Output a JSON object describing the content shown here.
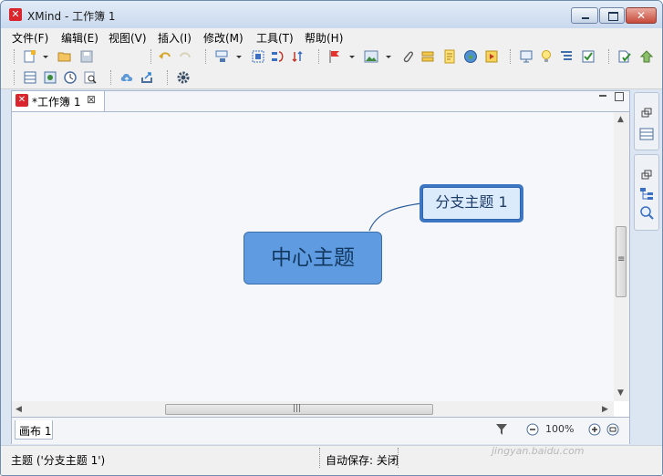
{
  "window": {
    "title": "XMind - 工作簿 1",
    "logo_icon": "xmind-logo-icon",
    "close_glyph": "✕"
  },
  "menubar": {
    "items": [
      "文件(F)",
      "编辑(E)",
      "视图(V)",
      "插入(I)",
      "修改(M)",
      "工具(T)",
      "帮助(H)"
    ]
  },
  "toolbar": {
    "row1_icons": [
      "new-workbook-icon",
      "dropdown-arrow-icon",
      "open-folder-icon",
      "save-icon",
      "undo-icon",
      "redo-icon",
      "insert-topic-icon",
      "dropdown-arrow-icon",
      "boundary-icon",
      "relationship-icon",
      "summary-icon",
      "flag-marker-icon",
      "dropdown-arrow-icon",
      "image-icon",
      "dropdown-arrow-icon",
      "attachment-icon",
      "label-icon",
      "note-icon",
      "hyperlink-globe-icon",
      "audio-note-icon",
      "presentation-icon",
      "idea-lightbulb-icon",
      "outliner-icon",
      "task-icon",
      "spellcheck-icon",
      "go-up-icon"
    ],
    "row2_icons": [
      "sheet-icon",
      "image-export-icon",
      "clock-icon",
      "search-icon",
      "upload-cloud-icon",
      "share-icon",
      "preferences-gear-icon"
    ]
  },
  "editor": {
    "tab_label": "*工作簿 1",
    "tab_close_glyph": "⊠",
    "central_topic": "中心主题",
    "branch_topic": "分支主题 1",
    "sheet_tab": "画布 1",
    "zoom_level": "100%",
    "hscroll_grip": "|||",
    "vscroll_grip": "≡",
    "scroll_left": "◀",
    "scroll_right": "▶",
    "scroll_up": "▲",
    "scroll_down": "▼"
  },
  "statusbar": {
    "selection": "主题 ('分支主题 1')",
    "autosave": "自动保存: 关闭",
    "watermark": "jingyan.baidu.com"
  },
  "colors": {
    "central_topic_fill": "#5f9be1",
    "branch_topic_fill": "#dcebfb",
    "branch_topic_border": "#3d77c4",
    "canvas_bg": "#f6f7fb",
    "logo_red": "#d9252b"
  }
}
